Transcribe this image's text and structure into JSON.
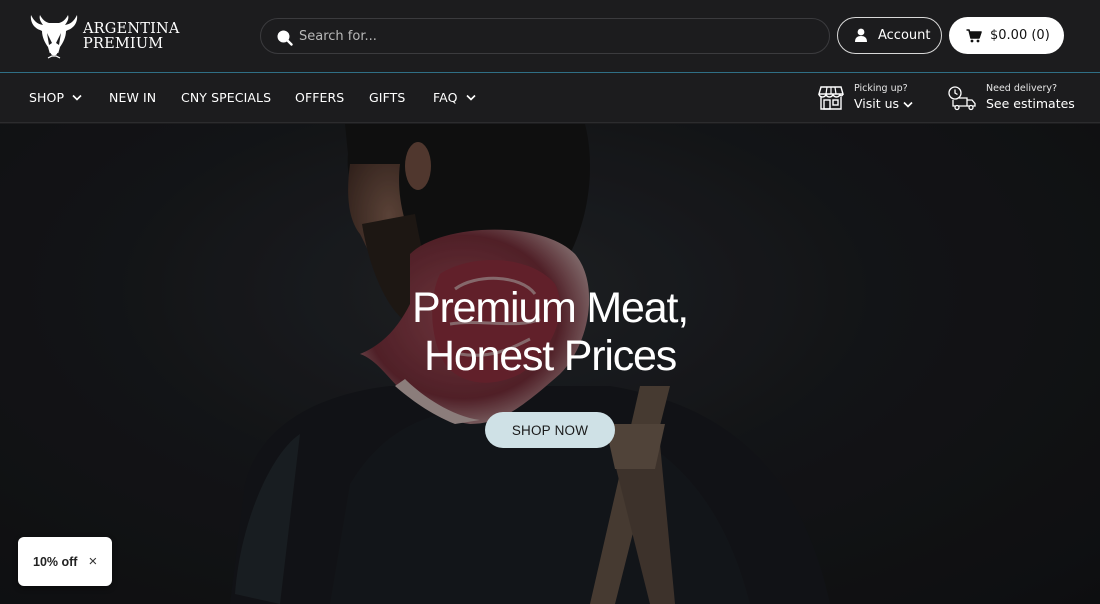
{
  "brand": {
    "line1": "ARGENTINA",
    "line2": "PREMIUM",
    "logo_icon": "bull-head-icon"
  },
  "search": {
    "placeholder": "Search for...",
    "value": "",
    "icon": "search-icon"
  },
  "header": {
    "account_label": "Account",
    "account_icon": "user-icon",
    "cart_label": "$0.00 (0)",
    "cart_icon": "cart-icon"
  },
  "nav": {
    "items": [
      {
        "label": "SHOP",
        "dropdown": true
      },
      {
        "label": "NEW IN",
        "dropdown": false
      },
      {
        "label": "CNY SPECIALS",
        "dropdown": false
      },
      {
        "label": "OFFERS",
        "dropdown": false
      },
      {
        "label": "GIFTS",
        "dropdown": false
      },
      {
        "label": "FAQ",
        "dropdown": true
      }
    ],
    "pickup": {
      "small": "Picking up?",
      "big": "Visit us",
      "icon": "storefront-icon"
    },
    "delivery": {
      "small": "Need delivery?",
      "big": "See estimates",
      "icon": "delivery-truck-icon"
    }
  },
  "hero": {
    "title_line1": "Premium Meat,",
    "title_line2": "Honest Prices",
    "cta_label": "SHOP NOW"
  },
  "discount": {
    "label": "10% off",
    "close_glyph": "×"
  },
  "colors": {
    "background": "#1c1c1e",
    "header_divider": "#2f6f86",
    "cta_bg": "#cfe1e6",
    "cart_bg": "#ffffff"
  }
}
